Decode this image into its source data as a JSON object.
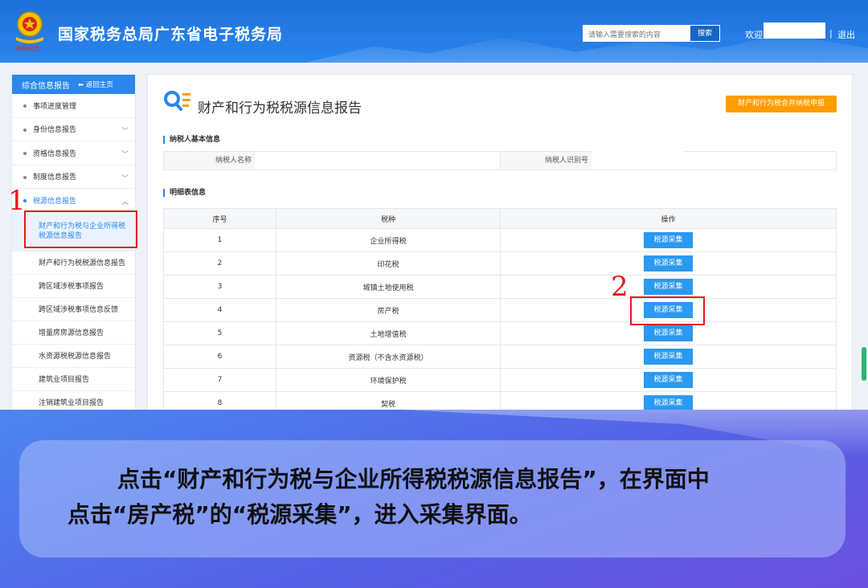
{
  "header": {
    "site_title": "国家税务总局广东省电子税务局",
    "search_placeholder": "请输入需要搜索的内容",
    "search_button": "搜索",
    "welcome": "欢迎",
    "separator": "|",
    "logout": "退出"
  },
  "sidebar": {
    "top_label": "综合信息报告",
    "back_label": "返回主页",
    "items": [
      {
        "label": "事项进度管理",
        "chevron": ""
      },
      {
        "label": "身份信息报告",
        "chevron": "﹀"
      },
      {
        "label": "资格信息报告",
        "chevron": "﹀"
      },
      {
        "label": "制度信息报告",
        "chevron": "﹀"
      },
      {
        "label": "税源信息报告",
        "chevron": "︿"
      }
    ],
    "sub_items": [
      "财产和行为税与企业所得税税源信息报告",
      "财产和行为税税源信息报告",
      "跨区域涉税事项报告",
      "跨区域涉税事项信息反馈",
      "增量房房源信息报告",
      "水资源税税源信息报告",
      "建筑业项目报告",
      "注销建筑业项目报告"
    ],
    "marker_number": "1"
  },
  "main": {
    "title": "财产和行为税税源信息报告",
    "combined_button": "财产和行为税合并纳税申报",
    "basic_section": "纳税人基本信息",
    "name_label": "纳税人名称",
    "id_label": "纳税人识别号",
    "detail_section": "明细表信息",
    "table_headers": [
      "序号",
      "税种",
      "操作"
    ],
    "rows": [
      {
        "no": "1",
        "tax": "企业所得税",
        "op": "税源采集"
      },
      {
        "no": "2",
        "tax": "印花税",
        "op": "税源采集"
      },
      {
        "no": "3",
        "tax": "城镇土地使用税",
        "op": "税源采集"
      },
      {
        "no": "4",
        "tax": "房产税",
        "op": "税源采集"
      },
      {
        "no": "5",
        "tax": "土地增值税",
        "op": "税源采集"
      },
      {
        "no": "6",
        "tax": "资源税（不含水资源税）",
        "op": "税源采集"
      },
      {
        "no": "7",
        "tax": "环境保护税",
        "op": "税源采集"
      },
      {
        "no": "8",
        "tax": "契税",
        "op": "税源采集"
      }
    ],
    "marker_number": "2"
  },
  "caption": {
    "line1": "点击“财产和行为税与企业所得税税源信息报告”，在界面中",
    "line2": "点击“房产税”的“税源采集”，进入采集界面。"
  },
  "colors": {
    "header_blue": "#2a86ee",
    "accent_blue": "#2b87ee",
    "button_blue": "#2b99f0",
    "orange": "#ff9c00",
    "highlight_red": "#e31b1b"
  }
}
